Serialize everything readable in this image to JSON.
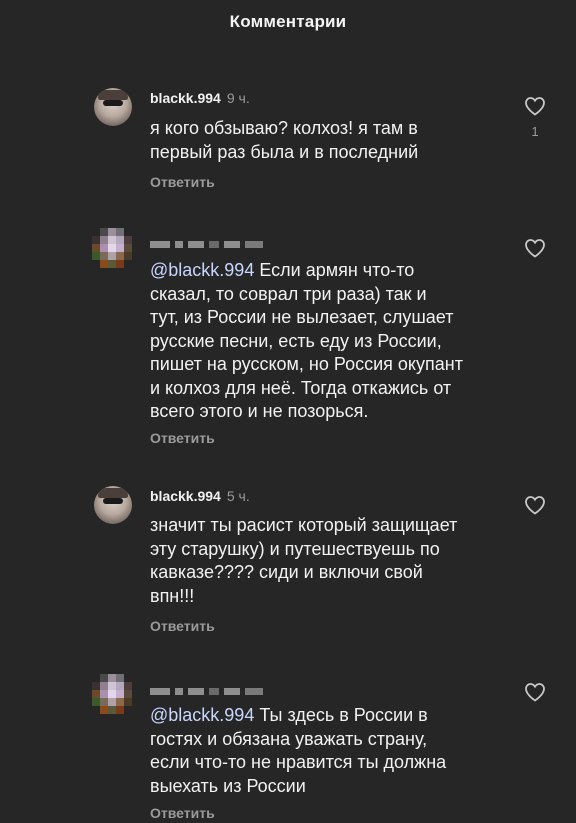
{
  "header": {
    "title": "Комментарии"
  },
  "comments": [
    {
      "username": "blackk.994",
      "time": "9 ч.",
      "lines": [
        "я кого обзываю? колхоз! я там в",
        "первый раз была и в последний"
      ],
      "reply": "Ответить",
      "likes": "1"
    },
    {
      "mention": "@blackk.994",
      "lines_after_mention": " Если армян что-то",
      "lines": [
        "сказал, то соврал три раза) так и",
        "тут, из России не вылезает, слушает",
        "русские песни, есть еду из России,",
        "пишет на русском, но Россия окупант",
        "и колхоз для неё. Тогда откажись от",
        "всего этого и не позорься."
      ],
      "reply": "Ответить"
    },
    {
      "username": "blackk.994",
      "time": "5 ч.",
      "lines": [
        "значит ты расист который защищает",
        "эту старушку) и путешествуешь по",
        "кавказе???? сиди и включи свой",
        "впн!!!"
      ],
      "reply": "Ответить"
    },
    {
      "mention": "@blackk.994",
      "lines_after_mention": " Ты здесь в России в",
      "lines": [
        "гостях и обязана уважать страну,",
        "если что-то не нравится ты должна",
        "выехать из России"
      ],
      "reply": "Ответить"
    }
  ],
  "colors": {
    "background": "#262626",
    "text": "#f2f2f2",
    "muted": "#9a9a9a",
    "mention": "#c9d6ff"
  },
  "icons": {
    "like": "heart-outline-icon"
  }
}
